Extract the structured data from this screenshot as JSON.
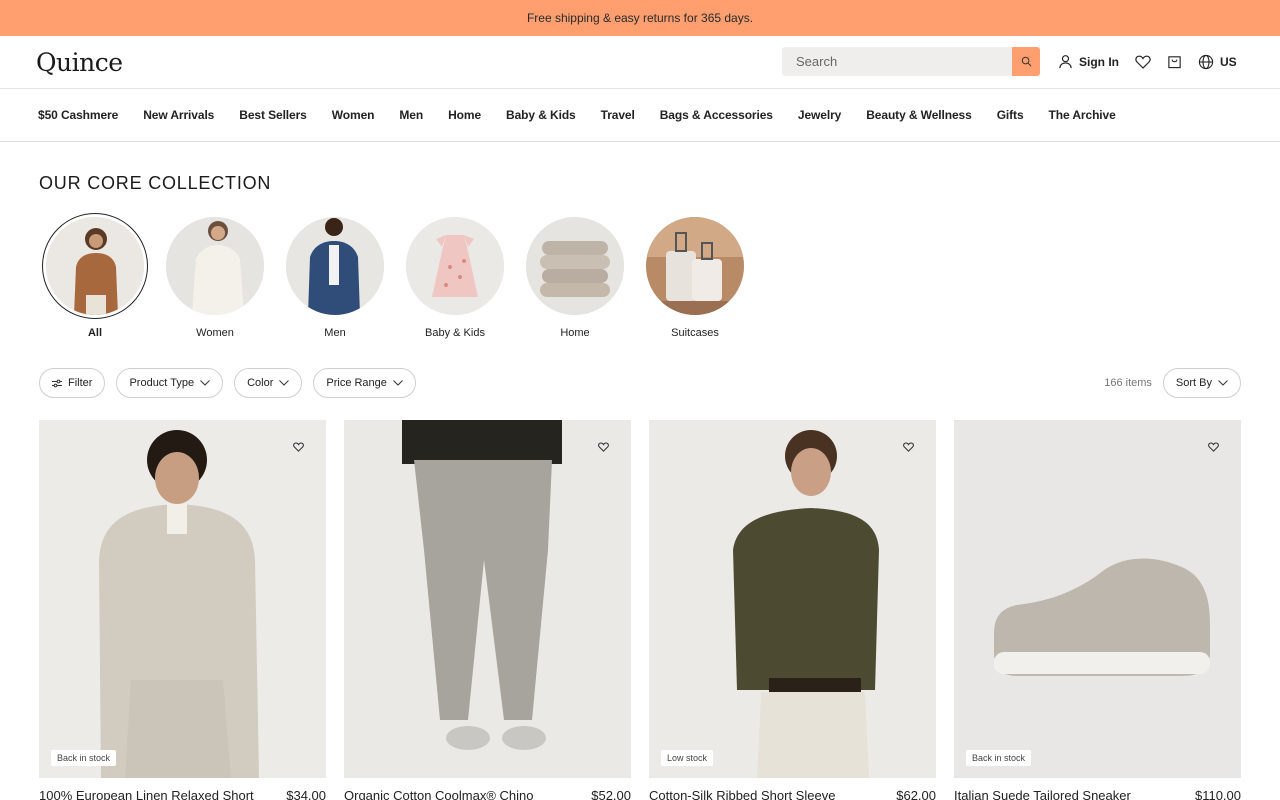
{
  "announcement": "Free shipping & easy returns for 365 days.",
  "header": {
    "logo": "Quince",
    "search_placeholder": "Search",
    "sign_in": "Sign In",
    "region": "US"
  },
  "nav": [
    "$50 Cashmere",
    "New Arrivals",
    "Best Sellers",
    "Women",
    "Men",
    "Home",
    "Baby & Kids",
    "Travel",
    "Bags & Accessories",
    "Jewelry",
    "Beauty & Wellness",
    "Gifts",
    "The Archive"
  ],
  "section_title": "OUR CORE COLLECTION",
  "categories": [
    {
      "label": "All",
      "active": true
    },
    {
      "label": "Women",
      "active": false
    },
    {
      "label": "Men",
      "active": false
    },
    {
      "label": "Baby & Kids",
      "active": false
    },
    {
      "label": "Home",
      "active": false
    },
    {
      "label": "Suitcases",
      "active": false
    }
  ],
  "filters": {
    "filter": "Filter",
    "product_type": "Product Type",
    "color": "Color",
    "price_range": "Price Range",
    "count": "166 items",
    "sort": "Sort By"
  },
  "products": [
    {
      "name": "100% European Linen Relaxed Short",
      "price": "$34.00",
      "badge": "Back in stock"
    },
    {
      "name": "Organic Cotton Coolmax® Chino",
      "price": "$52.00",
      "badge": ""
    },
    {
      "name": "Cotton-Silk Ribbed Short Sleeve",
      "price": "$62.00",
      "badge": "Low stock"
    },
    {
      "name": "Italian Suede Tailored Sneaker",
      "price": "$110.00",
      "badge": "Back in stock"
    }
  ],
  "colors": {
    "accent": "#ff9f70"
  }
}
